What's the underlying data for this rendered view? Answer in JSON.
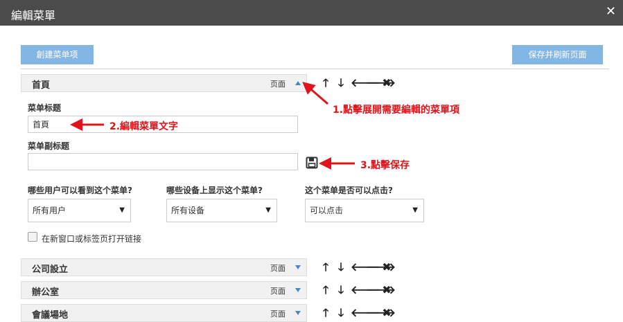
{
  "dialog": {
    "title": "編輯菜單",
    "close_glyph": "✕"
  },
  "toolbar": {
    "create_label": "創建菜单项",
    "save_label": "保存并刷新页面"
  },
  "menu_items": [
    {
      "name": "首頁",
      "type": "页面"
    },
    {
      "name": "公司設立",
      "type": "页面"
    },
    {
      "name": "辦公室",
      "type": "页面"
    },
    {
      "name": "會議場地",
      "type": "页面"
    }
  ],
  "actions": {
    "up": "🡑",
    "down": "🡓",
    "left": "🡐",
    "right": "🡒",
    "delete": "✖"
  },
  "form": {
    "title_label": "菜单标题",
    "title_value": "首頁",
    "subtitle_label": "菜单副标题",
    "subtitle_value": "",
    "users_label": "哪些用户可以看到这个菜单?",
    "users_value": "所有用户",
    "devices_label": "哪些设备上显示这个菜单?",
    "devices_value": "所有设备",
    "clickable_label": "这个菜单是否可以点击?",
    "clickable_value": "可以点击",
    "new_window_label": "在新窗口或标签页打开链接"
  },
  "annotations": {
    "step1": "1.點擊展開需要編輯的菜單項",
    "step2": "2.編輯菜單文字",
    "step3": "3.點擊保存"
  },
  "colors": {
    "accent_button": "#82b6e4",
    "titlebar": "#4b4b4b",
    "annotation": "#e0141a",
    "toggle": "#4a86c5"
  },
  "icons": {
    "toggle_open": "triangle-up-icon",
    "toggle_closed": "triangle-down-icon",
    "save": "floppy-disk-icon"
  }
}
